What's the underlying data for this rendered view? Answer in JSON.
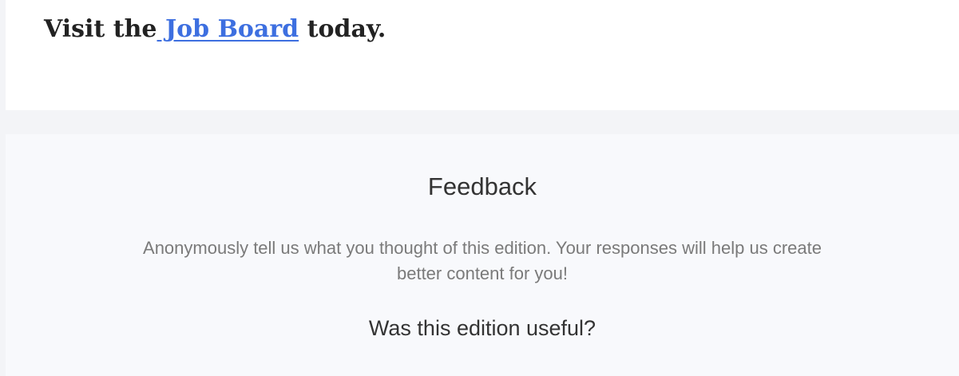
{
  "job_board": {
    "prefix": "Visit the",
    "link_label": " Job Board",
    "suffix": " today."
  },
  "feedback": {
    "title": "Feedback",
    "description": "Anonymously tell us what you thought of this edition. Your responses will help us create better content for you!",
    "question": "Was this edition useful?"
  },
  "colors": {
    "link": "#3d6fe0",
    "page_background": "#f3f4f7",
    "card_background": "#ffffff",
    "feedback_background": "#f8f9fc"
  }
}
